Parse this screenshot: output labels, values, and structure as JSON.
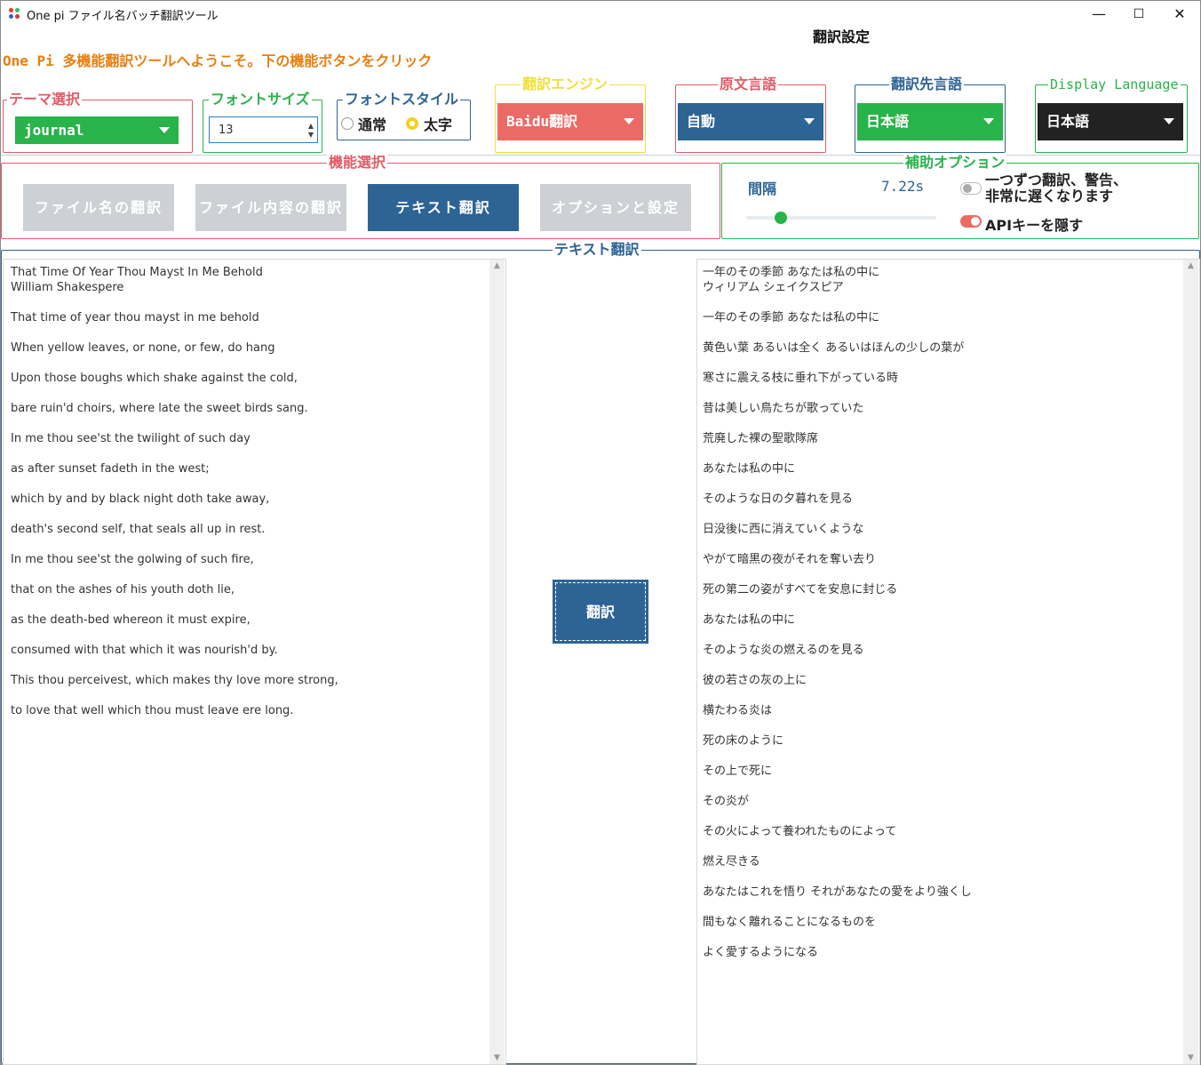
{
  "window": {
    "title": "One pi ファイル名バッチ翻訳ツール",
    "minimize": "—",
    "maximize": "☐",
    "close": "✕"
  },
  "settings_title": "翻訳設定",
  "welcome": "One Pi 多機能翻訳ツールへようこそ。下の機能ボタンをクリック",
  "theme": {
    "label": "テーマ選択",
    "value": "journal"
  },
  "font_size": {
    "label": "フォントサイズ",
    "value": "13"
  },
  "font_style": {
    "label": "フォントスタイル",
    "options": [
      "通常",
      "太字"
    ],
    "selected": "太字"
  },
  "engine": {
    "label": "翻訳エンジン",
    "value": "Baidu翻訳"
  },
  "source_lang": {
    "label": "原文言語",
    "value": "自動"
  },
  "target_lang": {
    "label": "翻訳先言語",
    "value": "日本語"
  },
  "display_lang": {
    "label": "Display Language",
    "value": "日本語"
  },
  "function_select": {
    "label": "機能選択",
    "buttons": [
      "ファイル名の翻訳",
      "ファイル内容の翻訳",
      "テキスト翻訳",
      "オプションと設定"
    ],
    "active": "テキスト翻訳"
  },
  "aux_options": {
    "label": "補助オプション",
    "interval_label": "間隔",
    "interval_value": "7.22s",
    "slider_fraction": 0.15,
    "one_by_one_line1": "一つずつ翻訳、警告、",
    "one_by_one_line2": "非常に遅くなります",
    "one_by_one_on": false,
    "hide_api": "APIキーを隠す",
    "hide_api_on": true
  },
  "text_translate": {
    "label": "テキスト翻訳",
    "button": "翻訳",
    "source_text": "That Time Of Year Thou Mayst In Me Behold\nWilliam Shakespere\n\nThat time of year thou mayst in me behold\n\nWhen yellow leaves, or none, or few, do hang\n\nUpon those boughs which shake against the cold,\n\nbare ruin'd choirs, where late the sweet birds sang.\n\nIn me thou see'st the twilight of such day\n\nas after sunset fadeth in the west;\n\nwhich by and by black night doth take away,\n\ndeath's second self, that seals all up in rest.\n\nIn me thou see'st the golwing of such fire,\n\nthat on the ashes of his youth doth lie,\n\nas the death-bed whereon it must expire,\n\nconsumed with that which it was nourish'd by.\n\nThis thou perceivest, which makes thy love more strong,\n\nto love that well which thou must leave ere long.",
    "result_text": "一年のその季節 あなたは私の中に\nウィリアム シェイクスピア\n\n一年のその季節 あなたは私の中に\n\n黄色い葉 あるいは全く あるいはほんの少しの葉が\n\n寒さに震える枝に垂れ下がっている時\n\n昔は美しい鳥たちが歌っていた\n\n荒廃した裸の聖歌隊席\n\nあなたは私の中に\n\nそのような日の夕暮れを見る\n\n日没後に西に消えていくような\n\nやがて暗黒の夜がそれを奪い去り\n\n死の第二の姿がすべてを安息に封じる\n\nあなたは私の中に\n\nそのような炎の燃えるのを見る\n\n彼の若さの灰の上に\n\n横たわる炎は\n\n死の床のように\n\nその上で死に\n\nその炎が\n\nその火によって養われたものによって\n\n燃え尽きる\n\nあなたはこれを悟り それがあなたの愛をより強くし\n\n間もなく離れることになるものを\n\nよく愛するようになる"
  },
  "colors": {
    "theme_green": "#28b34b",
    "engine_red": "#ec6a65",
    "lang_blue": "#2e6494",
    "dark": "#222222",
    "welcome_orange": "#e87f12",
    "engine_label_yellow": "#f0e03a"
  }
}
